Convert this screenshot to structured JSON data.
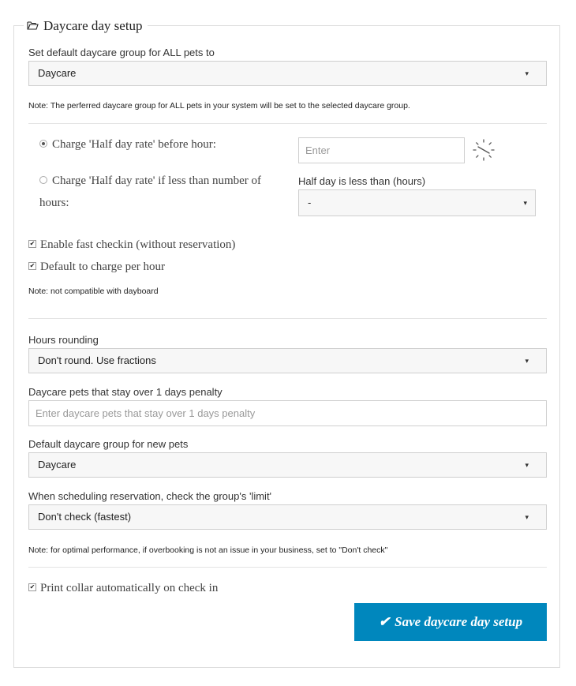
{
  "legend": "Daycare day setup",
  "default_group": {
    "label": "Set default daycare group for ALL pets to",
    "value": "Daycare",
    "note": "Note: The perferred daycare group for ALL pets in your system will be set to the selected daycare group."
  },
  "half_day": {
    "option_before_hour": "Charge 'Half day rate' before hour:",
    "hour_placeholder": "Enter",
    "option_less_than": "Charge 'Half day rate' if less than number of",
    "option_less_than_cont": "hours:",
    "hours_label": "Half day is less than (hours)",
    "hours_value": "-"
  },
  "checkin": {
    "fast_checkin": "Enable fast checkin (without reservation)",
    "charge_per_hour": "Default to charge per hour",
    "note": "Note: not compatible with dayboard"
  },
  "rounding": {
    "label": "Hours rounding",
    "value": "Don't round. Use fractions"
  },
  "penalty": {
    "label": "Daycare pets that stay over 1 days penalty",
    "placeholder": "Enter daycare pets that stay over 1 days penalty"
  },
  "new_pets_group": {
    "label": "Default daycare group for new pets",
    "value": "Daycare"
  },
  "limit_check": {
    "label": "When scheduling reservation, check the group's 'limit'",
    "value": "Don't check (fastest)",
    "note": "Note: for optimal performance, if overbooking is not an issue in your business, set to \"Don't check\""
  },
  "print_collar": "Print collar automatically on check in",
  "save_button": "Save daycare day setup"
}
